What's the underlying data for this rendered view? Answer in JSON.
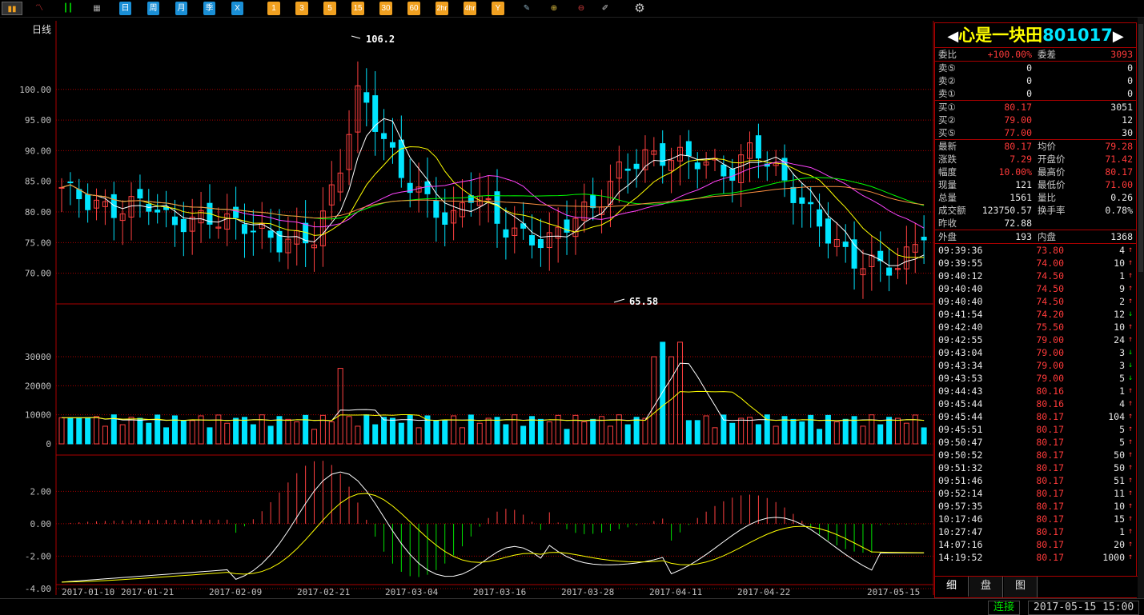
{
  "toolbar": {
    "items": [
      "日",
      "周",
      "月",
      "季",
      "X",
      "1",
      "3",
      "5",
      "15",
      "30",
      "60",
      "2hr",
      "4hr",
      "Y"
    ]
  },
  "chart": {
    "period_label": "日线",
    "high_label": "106.2",
    "low_label": "65.58",
    "price_ticks": [
      "100.00",
      "95.00",
      "90.00",
      "85.00",
      "80.00",
      "75.00",
      "70.00"
    ],
    "volume_ticks": [
      "30000",
      "20000",
      "10000",
      "0"
    ],
    "macd_ticks": [
      "2.00",
      "0.00",
      "-2.00",
      "-4.00"
    ],
    "dates": [
      "2017-01-10",
      "2017-01-21",
      "2017-02-09",
      "2017-02-21",
      "2017-03-04",
      "2017-03-16",
      "2017-03-28",
      "2017-04-11",
      "2017-04-22",
      "2017-05-15"
    ]
  },
  "chart_data": {
    "type": "candlestick",
    "price_axis": [
      70,
      100
    ],
    "volume_axis": [
      0,
      30000
    ],
    "macd_axis": [
      -4,
      2
    ],
    "high": 106.2,
    "low": 65.58
  },
  "panel": {
    "name": "心是一块田",
    "code": "801017",
    "wb": {
      "l1": "委比",
      "v1": "+100.00%",
      "l2": "委差",
      "v2": "3093"
    },
    "asks": [
      {
        "label": "卖⑤",
        "price": "0",
        "vol": "0"
      },
      {
        "label": "卖②",
        "price": "0",
        "vol": "0"
      },
      {
        "label": "卖①",
        "price": "0",
        "vol": "0"
      }
    ],
    "bids": [
      {
        "label": "买①",
        "price": "80.17",
        "vol": "3051"
      },
      {
        "label": "买②",
        "price": "79.00",
        "vol": "12"
      },
      {
        "label": "买⑤",
        "price": "77.00",
        "vol": "30"
      }
    ],
    "quote": [
      {
        "l1": "最新",
        "v1": "80.17",
        "l2": "均价",
        "v2": "79.28"
      },
      {
        "l1": "涨跌",
        "v1": "7.29",
        "l2": "开盘价",
        "v2": "71.42"
      },
      {
        "l1": "幅度",
        "v1": "10.00%",
        "l2": "最高价",
        "v2": "80.17"
      },
      {
        "l1": "现量",
        "v1": "121",
        "l2": "最低价",
        "v2": "71.00"
      },
      {
        "l1": "总量",
        "v1": "1561",
        "l2": "量比",
        "v2": "0.26"
      },
      {
        "l1": "成交额",
        "v1": "123750.57",
        "l2": "换手率",
        "v2": "0.78%"
      }
    ],
    "prev_close": {
      "label": "昨收",
      "value": "72.88"
    },
    "outer": {
      "l1": "外盘",
      "v1": "193",
      "l2": "内盘",
      "v2": "1368"
    },
    "ticks": [
      {
        "t": "09:39:36",
        "p": "73.80",
        "v": "4",
        "d": "up"
      },
      {
        "t": "09:39:55",
        "p": "74.00",
        "v": "10",
        "d": "up"
      },
      {
        "t": "09:40:12",
        "p": "74.50",
        "v": "1",
        "d": "up"
      },
      {
        "t": "09:40:40",
        "p": "74.50",
        "v": "9",
        "d": "up"
      },
      {
        "t": "09:40:40",
        "p": "74.50",
        "v": "2",
        "d": "up"
      },
      {
        "t": "09:41:54",
        "p": "74.20",
        "v": "12",
        "d": "down"
      },
      {
        "t": "09:42:40",
        "p": "75.50",
        "v": "10",
        "d": "up"
      },
      {
        "t": "09:42:55",
        "p": "79.00",
        "v": "24",
        "d": "up"
      },
      {
        "t": "09:43:04",
        "p": "79.00",
        "v": "3",
        "d": "down"
      },
      {
        "t": "09:43:34",
        "p": "79.00",
        "v": "3",
        "d": "down"
      },
      {
        "t": "09:43:53",
        "p": "79.00",
        "v": "5",
        "d": "down"
      },
      {
        "t": "09:44:43",
        "p": "80.16",
        "v": "1",
        "d": "up"
      },
      {
        "t": "09:45:44",
        "p": "80.16",
        "v": "4",
        "d": "up"
      },
      {
        "t": "09:45:44",
        "p": "80.17",
        "v": "104",
        "d": "up"
      },
      {
        "t": "09:45:51",
        "p": "80.17",
        "v": "5",
        "d": "up"
      },
      {
        "t": "09:50:47",
        "p": "80.17",
        "v": "5",
        "d": "up"
      },
      {
        "t": "09:50:52",
        "p": "80.17",
        "v": "50",
        "d": "up"
      },
      {
        "t": "09:51:32",
        "p": "80.17",
        "v": "50",
        "d": "up"
      },
      {
        "t": "09:51:46",
        "p": "80.17",
        "v": "51",
        "d": "up"
      },
      {
        "t": "09:52:14",
        "p": "80.17",
        "v": "11",
        "d": "up"
      },
      {
        "t": "09:57:35",
        "p": "80.17",
        "v": "10",
        "d": "up"
      },
      {
        "t": "10:17:46",
        "p": "80.17",
        "v": "15",
        "d": "up"
      },
      {
        "t": "10:27:47",
        "p": "80.17",
        "v": "1",
        "d": "up"
      },
      {
        "t": "14:07:16",
        "p": "80.17",
        "v": "20",
        "d": "up"
      },
      {
        "t": "14:19:52",
        "p": "80.17",
        "v": "1000",
        "d": "up"
      }
    ],
    "tabs": [
      "细",
      "盘",
      "图"
    ]
  },
  "status": {
    "connection": "连接",
    "datetime": "2017-05-15 15:00"
  },
  "colors": {
    "up": "#ff4040",
    "down": "#00e5ff",
    "grid": "#aa0000",
    "ma5": "#ffffff",
    "ma10": "#ffff00",
    "ma20": "#ff44ff",
    "ma30": "#00ff00",
    "ma60": "#ff9040"
  }
}
